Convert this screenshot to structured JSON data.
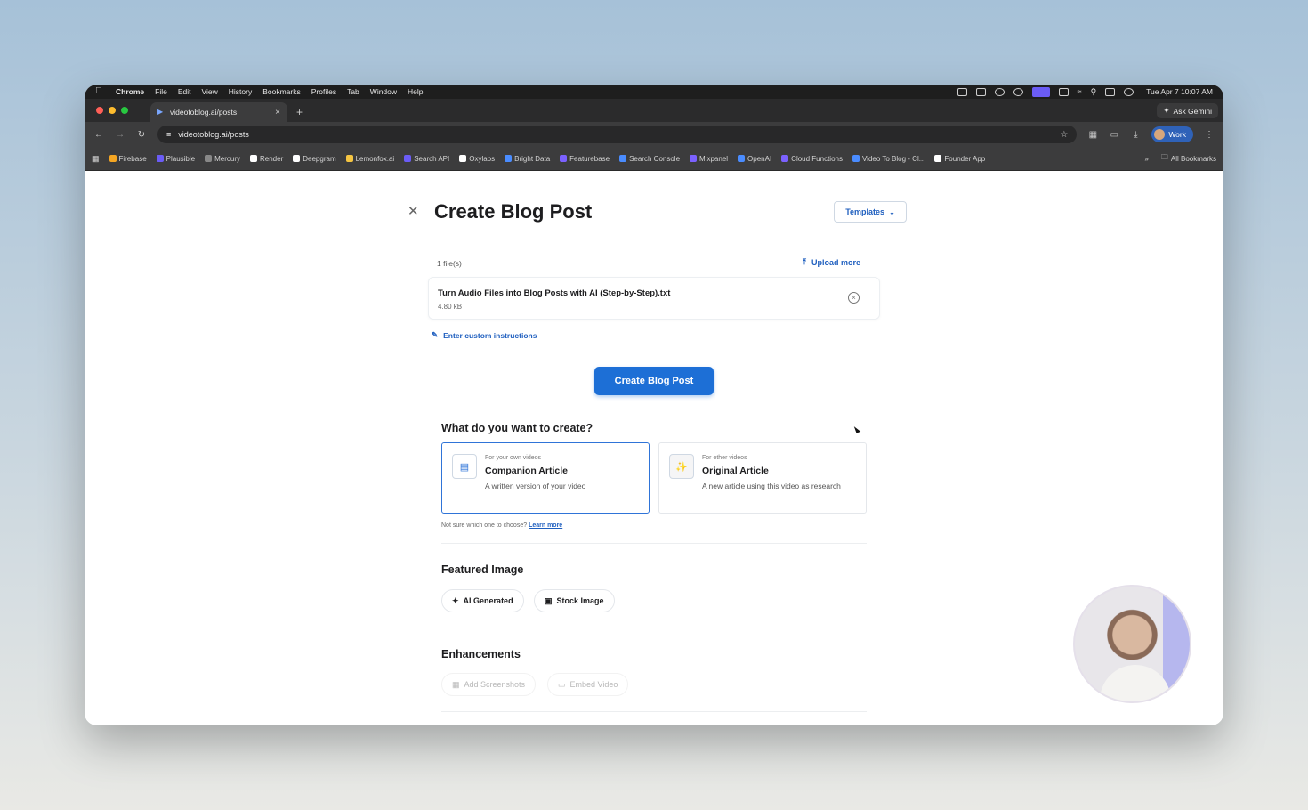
{
  "menubar": {
    "app": "Chrome",
    "items": [
      "File",
      "Edit",
      "View",
      "History",
      "Bookmarks",
      "Profiles",
      "Tab",
      "Window",
      "Help"
    ],
    "clock": "Tue Apr 7  10:07 AM"
  },
  "tab": {
    "title": "videotoblog.ai/posts"
  },
  "ask_gemini": "Ask Gemini",
  "address": {
    "url": "videotoblog.ai/posts"
  },
  "profile": {
    "label": "Work"
  },
  "bookmarks": {
    "items": [
      "Firebase",
      "Plausible",
      "Mercury",
      "Render",
      "Deepgram",
      "Lemonfox.ai",
      "Search API",
      "Oxylabs",
      "Bright Data",
      "Featurebase",
      "Search Console",
      "Mixpanel",
      "OpenAI",
      "Cloud Functions",
      "Video To Blog - Cl...",
      "Founder App"
    ],
    "colors": [
      "#f5a623",
      "#6b5cf6",
      "#888888",
      "#ffffff",
      "#ffffff",
      "#f5c542",
      "#6b5cf6",
      "#ffffff",
      "#4a8cff",
      "#7b61ff",
      "#4a8cff",
      "#7b61ff",
      "#4a8cff",
      "#7b61ff",
      "#4a8cff",
      "#ffffff"
    ],
    "all": "All Bookmarks"
  },
  "page": {
    "title": "Create Blog Post",
    "templates_label": "Templates",
    "files_count": "1 file(s)",
    "upload_more": "Upload more",
    "file": {
      "name": "Turn Audio Files into Blog Posts with AI (Step-by-Step).txt",
      "size": "4.80 kB"
    },
    "custom_instructions": "Enter custom instructions",
    "create_button": "Create Blog Post",
    "what_title": "What do you want to create?",
    "options": [
      {
        "sub": "For your own videos",
        "title": "Companion Article",
        "desc": "A written version of your video"
      },
      {
        "sub": "For other videos",
        "title": "Original Article",
        "desc": "A new article using this video as research"
      }
    ],
    "not_sure": "Not sure which one to choose?",
    "learn_more": "Learn more",
    "featured_title": "Featured Image",
    "featured_options": [
      "AI Generated",
      "Stock Image"
    ],
    "enhancements_title": "Enhancements",
    "enhancements": [
      "Add Screenshots",
      "Embed Video"
    ]
  }
}
